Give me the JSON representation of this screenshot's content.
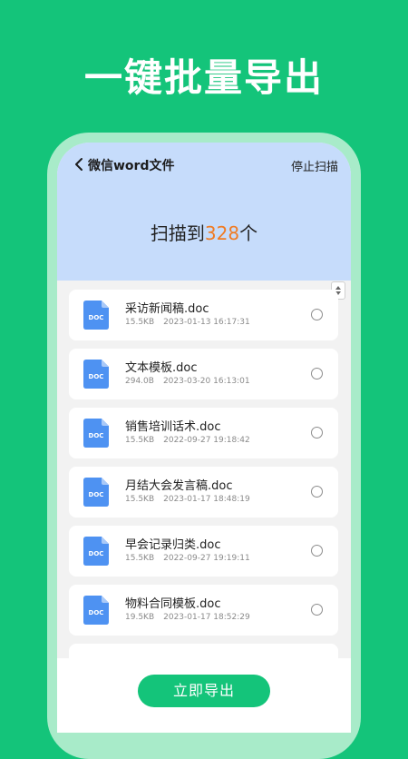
{
  "headline": "一键批量导出",
  "nav": {
    "title": "微信word文件",
    "stop_label": "停止扫描"
  },
  "scan": {
    "prefix": "扫描到",
    "count": "328",
    "suffix": "个"
  },
  "icon_label": "DOC",
  "files": [
    {
      "name": "采访新闻稿.doc",
      "size": "15.5KB",
      "date": "2023-01-13 16:17:31"
    },
    {
      "name": "文本模板.doc",
      "size": "294.0B",
      "date": "2023-03-20 16:13:01"
    },
    {
      "name": "销售培训话术.doc",
      "size": "15.5KB",
      "date": "2022-09-27 19:18:42"
    },
    {
      "name": "月结大会发言稿.doc",
      "size": "15.5KB",
      "date": "2023-01-17 18:48:19"
    },
    {
      "name": "早会记录归类.doc",
      "size": "15.5KB",
      "date": "2022-09-27 19:19:11"
    },
    {
      "name": "物料合同模板.doc",
      "size": "19.5KB",
      "date": "2023-01-17 18:52:29"
    }
  ],
  "export_label": "立即导出",
  "colors": {
    "brand_green": "#14c47a",
    "header_blue": "#c6dcfb",
    "count_orange": "#f07b23",
    "doc_icon_blue": "#4e92f2"
  }
}
